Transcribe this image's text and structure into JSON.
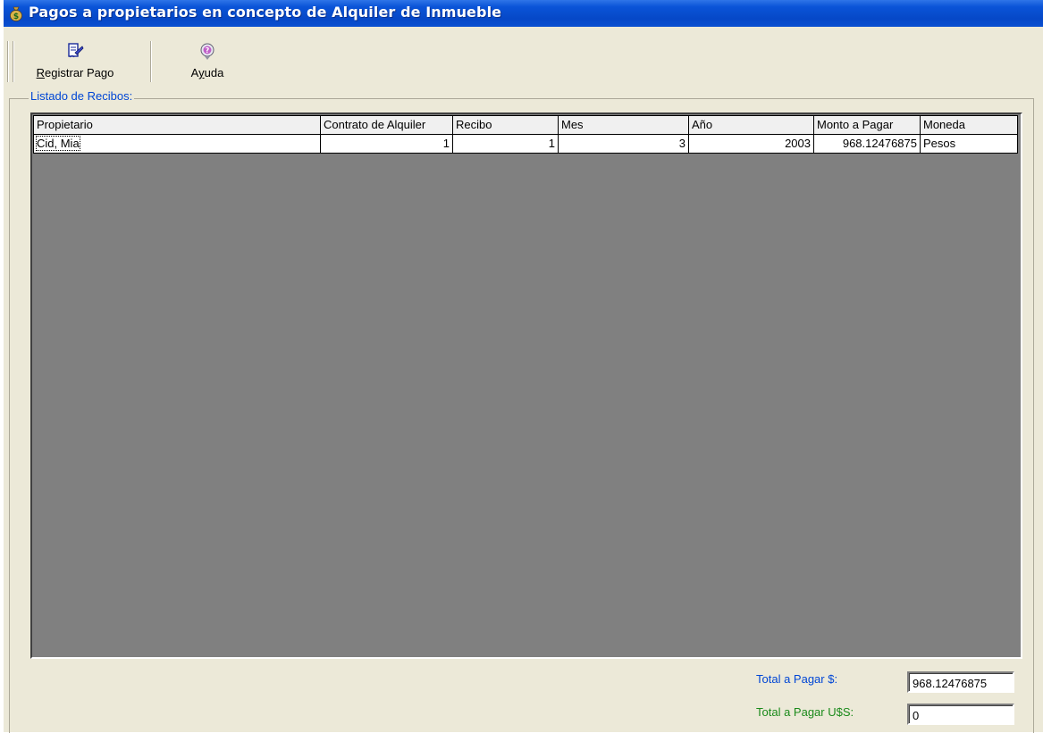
{
  "window": {
    "title": "Pagos a propietarios en concepto de Alquiler de Inmueble"
  },
  "toolbar": {
    "register_label": "Registrar Pago",
    "register_icon": "register-payment-icon",
    "help_label": "Ayuda",
    "help_icon": "help-icon"
  },
  "group": {
    "title": "Listado de Recibos:"
  },
  "table": {
    "columns": [
      "Propietario",
      "Contrato de Alquiler",
      "Recibo",
      "Mes",
      "Año",
      "Monto a Pagar",
      "Moneda"
    ],
    "rows": [
      [
        "Cid, Mia",
        "1",
        "1",
        "3",
        "2003",
        "968.12476875",
        "Pesos"
      ]
    ]
  },
  "totals": {
    "pesos_label": "Total a Pagar  $:",
    "pesos_value": "968.12476875",
    "dollars_label": "Total a Pagar  U$S:",
    "dollars_value": "0"
  },
  "colors": {
    "titlebar": "#0a54d8",
    "group_title": "#0046d5",
    "pesos_label": "#0046d5",
    "dollars_label": "#1a8a1a",
    "grid_background": "#808080"
  }
}
